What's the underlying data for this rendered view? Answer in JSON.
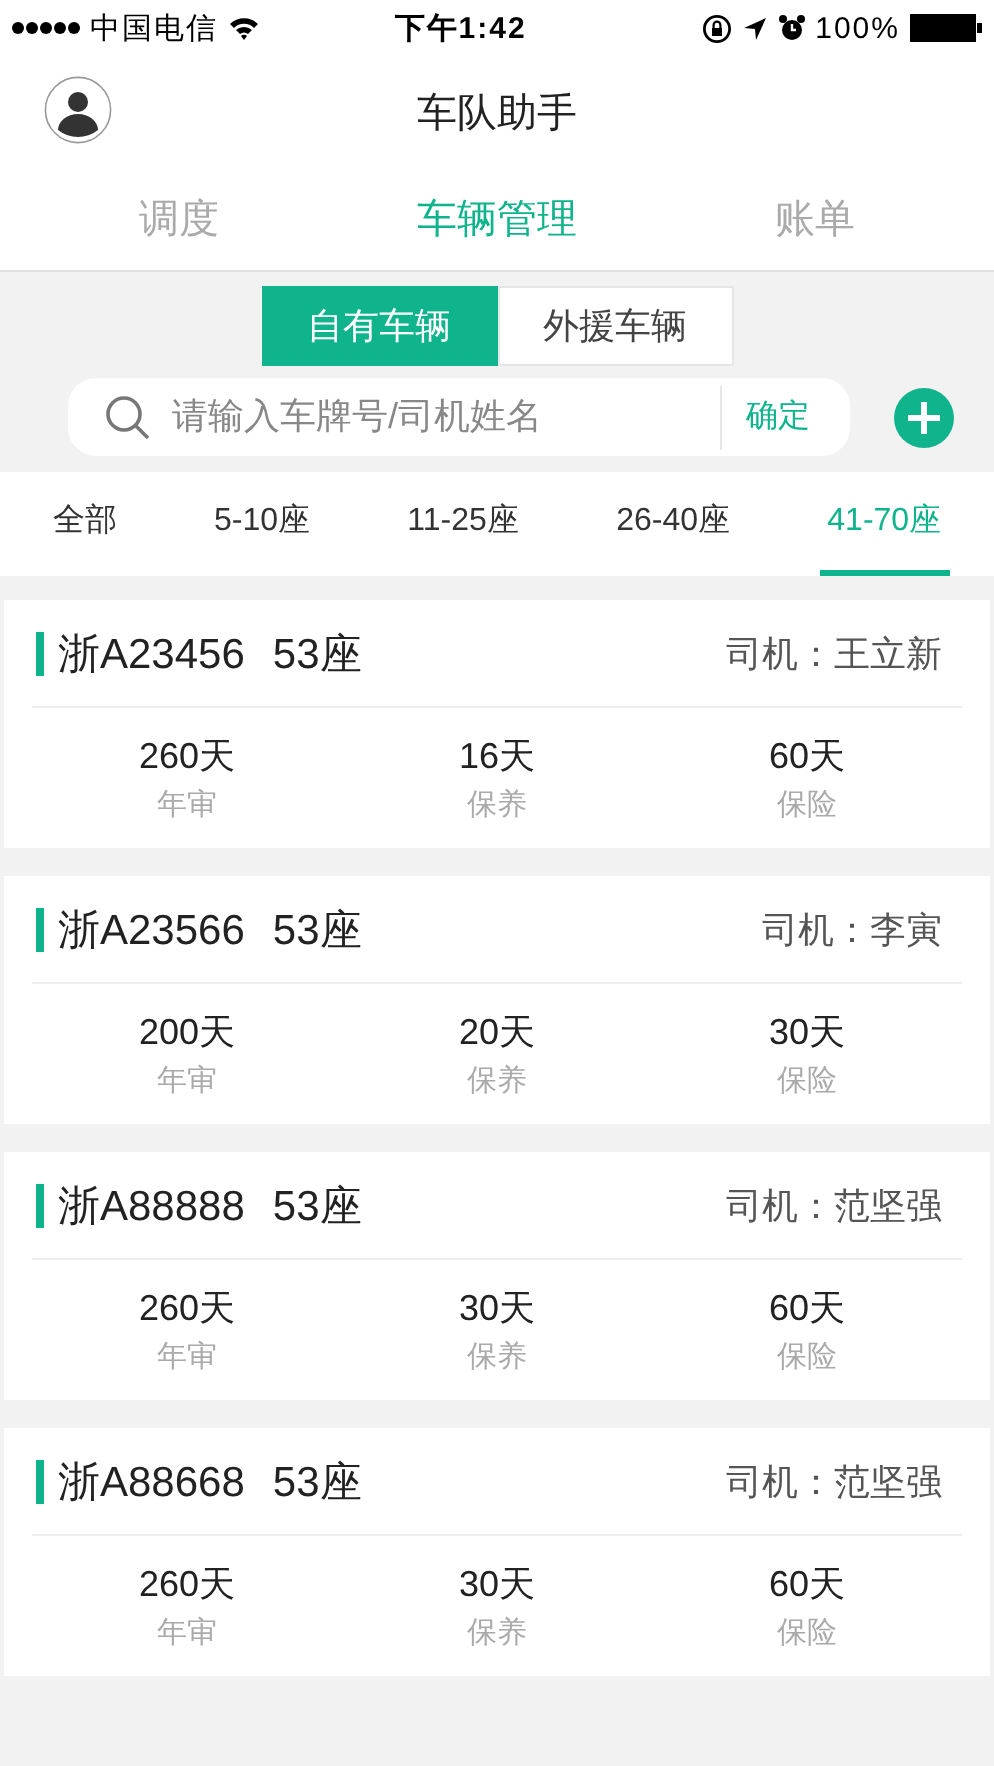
{
  "status_bar": {
    "carrier": "中国电信",
    "time": "下午1:42",
    "battery": "100%"
  },
  "header": {
    "title": "车队助手"
  },
  "tabs": [
    {
      "label": "调度",
      "selected": false
    },
    {
      "label": "车辆管理",
      "selected": true
    },
    {
      "label": "账单",
      "selected": false
    }
  ],
  "segments": [
    {
      "label": "自有车辆",
      "selected": true
    },
    {
      "label": "外援车辆",
      "selected": false
    }
  ],
  "search": {
    "placeholder": "请输入车牌号/司机姓名",
    "confirm": "确定"
  },
  "filters": [
    {
      "label": "全部",
      "selected": false
    },
    {
      "label": "5-10座",
      "selected": false
    },
    {
      "label": "11-25座",
      "selected": false
    },
    {
      "label": "26-40座",
      "selected": false
    },
    {
      "label": "41-70座",
      "selected": true
    }
  ],
  "vehicles": [
    {
      "plate": "浙A23456",
      "seats": "53座",
      "driver": "司机：王立新",
      "stats": [
        {
          "value": "260天",
          "label": "年审"
        },
        {
          "value": "16天",
          "label": "保养"
        },
        {
          "value": "60天",
          "label": "保险"
        }
      ]
    },
    {
      "plate": "浙A23566",
      "seats": "53座",
      "driver": "司机：李寅",
      "stats": [
        {
          "value": "200天",
          "label": "年审"
        },
        {
          "value": "20天",
          "label": "保养"
        },
        {
          "value": "30天",
          "label": "保险"
        }
      ]
    },
    {
      "plate": "浙A88888",
      "seats": "53座",
      "driver": "司机：范坚强",
      "stats": [
        {
          "value": "260天",
          "label": "年审"
        },
        {
          "value": "30天",
          "label": "保养"
        },
        {
          "value": "60天",
          "label": "保险"
        }
      ]
    },
    {
      "plate": "浙A88668",
      "seats": "53座",
      "driver": "司机：范坚强",
      "stats": [
        {
          "value": "260天",
          "label": "年审"
        },
        {
          "value": "30天",
          "label": "保养"
        },
        {
          "value": "60天",
          "label": "保险"
        }
      ]
    }
  ]
}
